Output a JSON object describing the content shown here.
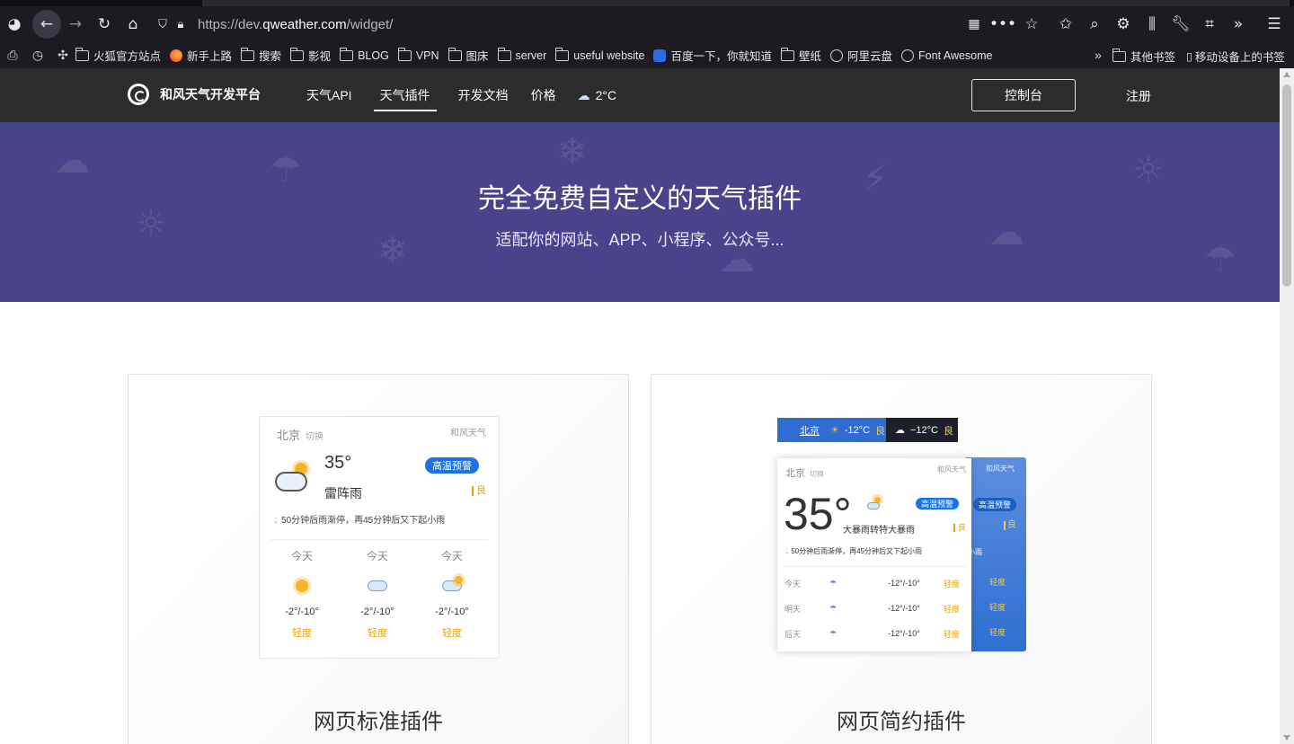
{
  "browser": {
    "url_prefix": "https://dev.",
    "url_host": "qweather.com",
    "url_suffix": "/widget/",
    "bookmarks": [
      {
        "label": "火狐官方站点",
        "type": "folder"
      },
      {
        "label": "新手上路",
        "type": "firefox"
      },
      {
        "label": "搜索",
        "type": "folder"
      },
      {
        "label": "影视",
        "type": "folder"
      },
      {
        "label": "BLOG",
        "type": "folder"
      },
      {
        "label": "VPN",
        "type": "folder"
      },
      {
        "label": "图床",
        "type": "folder"
      },
      {
        "label": "server",
        "type": "folder"
      },
      {
        "label": "useful website",
        "type": "folder"
      },
      {
        "label": "百度一下，你就知道",
        "type": "baidu"
      },
      {
        "label": "壁纸",
        "type": "folder"
      },
      {
        "label": "阿里云盘",
        "type": "globe"
      },
      {
        "label": "Font Awesome",
        "type": "globe"
      }
    ],
    "other_bookmarks": "其他书签",
    "mobile_bookmarks": "移动设备上的书签"
  },
  "site": {
    "logo_text": "和风天气开发平台",
    "nav": [
      "天气API",
      "天气插件",
      "开发文档",
      "价格"
    ],
    "active_nav": 1,
    "weather_temp": "2°C",
    "console": "控制台",
    "register": "注册"
  },
  "hero": {
    "title": "完全免费自定义的天气插件",
    "subtitle": "适配你的网站、APP、小程序、公众号..."
  },
  "standard_widget": {
    "city": "北京",
    "switch": "切换",
    "brand": "和风天气",
    "temp": "35°",
    "condition": "雷阵雨",
    "alert": "高温预警",
    "aqi": "良",
    "rain_note": "50分钟后雨渐停，再45分钟后又下起小雨",
    "forecast": [
      {
        "day": "今天",
        "temp": "-2°/-10°",
        "aqi": "轻度",
        "icon": "sun"
      },
      {
        "day": "今天",
        "temp": "-2°/-10°",
        "aqi": "轻度",
        "icon": "cloud"
      },
      {
        "day": "今天",
        "temp": "-2°/-10°",
        "aqi": "轻度",
        "icon": "partly-cloudy"
      }
    ],
    "caption": "网页标准插件"
  },
  "simple_widget": {
    "bar_city": "北京",
    "bar_temp": "-12°C",
    "bar_aqi": "良",
    "bar2_temp": "−12°C",
    "bar2_aqi": "良",
    "city": "北京",
    "switch": "切换",
    "brand": "和风天气",
    "back_brand": "和风天气",
    "temp": "35°",
    "condition": "大暴雨转特大暴雨",
    "alert": "高温预警",
    "back_alert": "高温预警",
    "aqi": "良",
    "back_aqi": "良",
    "rain_note": "50分钟后雨渐停，再45分钟后又下起小雨",
    "back_rain": "小雨",
    "forecast": [
      {
        "day": "今天",
        "temp": "-12°/-10°",
        "aqi": "轻度"
      },
      {
        "day": "明天",
        "temp": "-12°/-10°",
        "aqi": "轻度"
      },
      {
        "day": "后天",
        "temp": "-12°/-10°",
        "aqi": "轻度"
      }
    ],
    "back_aqi_list": [
      "轻度",
      "轻度",
      "轻度"
    ],
    "caption": "网页简约插件"
  },
  "colors": {
    "hero_bg": "#48438a",
    "nav_bg": "#2c2c2c",
    "accent": "#1a73e8",
    "aqi": "#e5a400"
  }
}
